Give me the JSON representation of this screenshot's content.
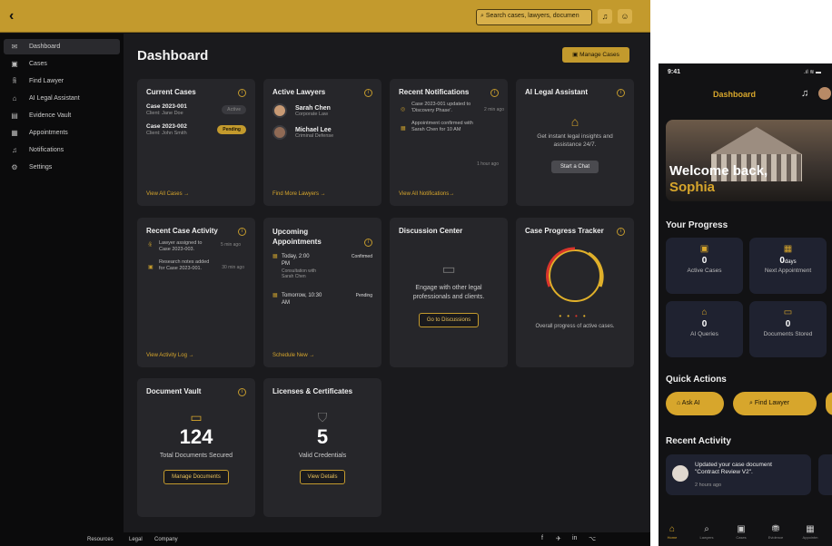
{
  "topbar": {
    "search_placeholder": "Search cases, lawyers, documen"
  },
  "sidebar": {
    "items": [
      {
        "label": "Dashboard",
        "icon": "mail-icon",
        "glyph": "✉"
      },
      {
        "label": "Cases",
        "icon": "briefcase-icon",
        "glyph": "▣"
      },
      {
        "label": "Find Lawyer",
        "icon": "users-icon",
        "glyph": "👥"
      },
      {
        "label": "AI Legal Assistant",
        "icon": "robot-icon",
        "glyph": "⌂"
      },
      {
        "label": "Evidence Vault",
        "icon": "file-icon",
        "glyph": "▤"
      },
      {
        "label": "Appointments",
        "icon": "calendar-icon",
        "glyph": "▦"
      },
      {
        "label": "Notifications",
        "icon": "bell-icon",
        "glyph": "♫"
      },
      {
        "label": "Settings",
        "icon": "gear-icon",
        "glyph": "⚙"
      }
    ]
  },
  "main": {
    "title": "Dashboard",
    "manage_label": "Manage Cases"
  },
  "cards": {
    "current_cases": {
      "title": "Current Cases",
      "link": "View All Cases →",
      "cases": [
        {
          "id": "Case 2023-001",
          "client": "Client: Jane Doe",
          "status": "Active"
        },
        {
          "id": "Case 2023-002",
          "client": "Client: John Smith",
          "status": "Pending"
        }
      ]
    },
    "active_lawyers": {
      "title": "Active Lawyers",
      "link": "Find More Lawyers →",
      "lawyers": [
        {
          "name": "Sarah Chen",
          "area": "Corporate Law"
        },
        {
          "name": "Michael Lee",
          "area": "Criminal Defense"
        }
      ]
    },
    "notifications": {
      "title": "Recent Notifications",
      "link": "View All Notifications→",
      "items": [
        {
          "text": "Case 2023-001 updated to 'Discovery Phase'.",
          "time": "2 min ago"
        },
        {
          "text": "Appointment confirmed with Sarah Chen for 10 AM",
          "time": "1 hour ago"
        }
      ]
    },
    "ai": {
      "title": "AI Legal Assistant",
      "desc": "Get instant legal insights and assistance 24/7.",
      "button": "Start a Chat"
    },
    "activity": {
      "title": "Recent Case Activity",
      "link": "View Activity Log →",
      "items": [
        {
          "text": "Lawyer assigned to Case 2023-003.",
          "time": "5 min ago"
        },
        {
          "text": "Research notes added for Case 2023-001.",
          "time": "30 min ago"
        }
      ]
    },
    "appointments": {
      "title": "Upcoming Appointments",
      "link": "Schedule New →",
      "items": [
        {
          "when": "Today, 2:00 PM",
          "sub": "Consultation with Sarah Chen",
          "status": "Confirmed"
        },
        {
          "when": "Tomorrow, 10:30 AM",
          "sub": "",
          "status": "Pending"
        }
      ]
    },
    "discussion": {
      "title": "Discussion Center",
      "desc": "Engage with other legal professionals and clients.",
      "button": "Go to Discussions"
    },
    "progress": {
      "title": "Case Progress Tracker",
      "desc": "Overall progress of active cases."
    },
    "vault": {
      "title": "Document Vault",
      "count": "124",
      "desc": "Total Documents Secured",
      "button": "Manage Documents"
    },
    "licenses": {
      "title": "Licenses & Certificates",
      "count": "5",
      "desc": "Valid Credentials",
      "button": "View Details"
    }
  },
  "footer": {
    "links": [
      "Resources",
      "Legal",
      "Company"
    ]
  },
  "mobile": {
    "time": "9:41",
    "title": "Dashboard",
    "welcome": "Welcome back,",
    "name": "Sophia",
    "progress_title": "Your Progress",
    "stats": [
      {
        "value": "0",
        "unit": "",
        "label": "Active Cases"
      },
      {
        "value": "0",
        "unit": "days",
        "label": "Next Appointment"
      },
      {
        "value": "0",
        "unit": "",
        "label": "AI Queries"
      },
      {
        "value": "0",
        "unit": "",
        "label": "Documents Stored"
      }
    ],
    "quick_title": "Quick Actions",
    "quick": [
      "Ask AI",
      "Find Lawyer"
    ],
    "recent_title": "Recent Activity",
    "recent": {
      "text": "Updated your case document \"Contract Review V2\".",
      "time": "2 hours ago"
    },
    "nav": [
      "Home",
      "Lawyers",
      "Cases",
      "Evidence",
      "Appointm"
    ]
  },
  "colors": {
    "accent": "#c39a2d",
    "active_badge": "#3a3a3f",
    "pending_badge": "#c39a2d"
  }
}
